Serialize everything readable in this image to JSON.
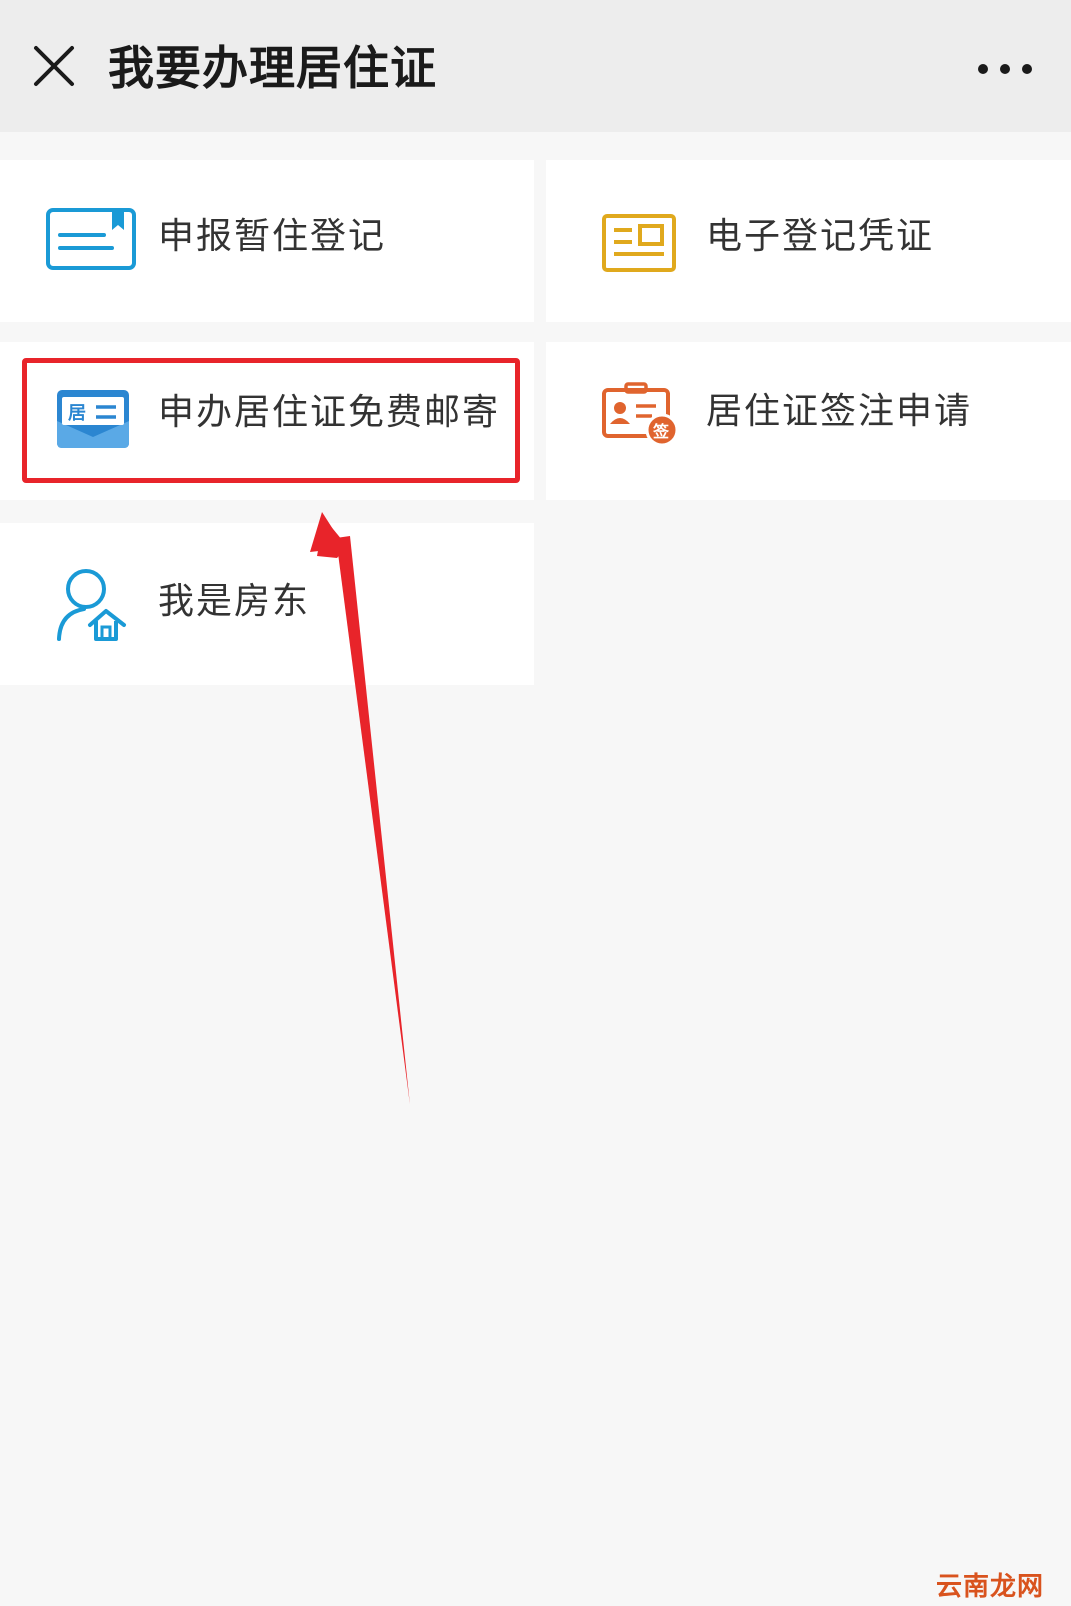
{
  "header": {
    "title": "我要办理居住证",
    "close_icon": "close-icon",
    "more_icon": "more-dots-icon"
  },
  "tiles": [
    {
      "label": "申报暂住登记",
      "icon": "registration-card-icon",
      "color": "#1a9ad6"
    },
    {
      "label": "电子登记凭证",
      "icon": "certificate-document-icon",
      "color": "#e0a91d"
    },
    {
      "label": "申办居住证免费邮寄",
      "icon": "residence-permit-mail-icon",
      "color": "#2b86d1"
    },
    {
      "label": "居住证签注申请",
      "icon": "id-badge-endorse-icon",
      "color": "#e0642e"
    },
    {
      "label": "我是房东",
      "icon": "landlord-house-icon",
      "color": "#1a9ad6"
    }
  ],
  "icon_text": {
    "residence": "居",
    "endorse": "签"
  },
  "annotation": {
    "highlight_color": "#e8242a"
  },
  "watermark": "云南龙网"
}
